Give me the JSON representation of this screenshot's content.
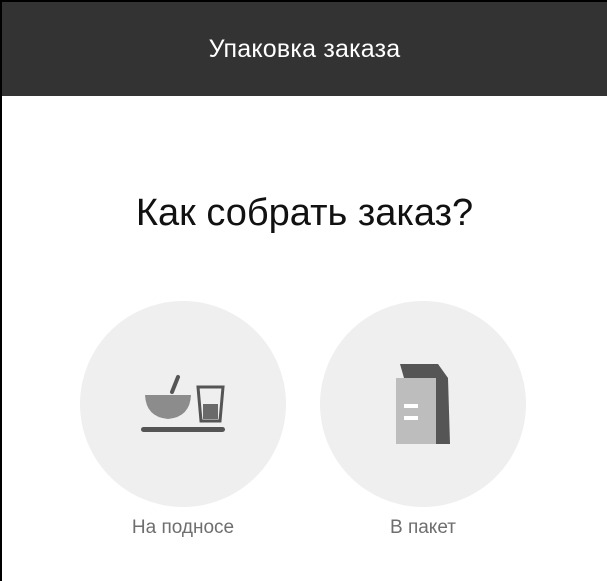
{
  "header": {
    "title": "Упаковка заказа"
  },
  "main": {
    "question": "Как собрать заказ?",
    "options": [
      {
        "label": "На подносе",
        "icon": "tray-icon"
      },
      {
        "label": "В пакет",
        "icon": "bag-icon"
      }
    ]
  },
  "colors": {
    "header_bg": "#333333",
    "circle_bg": "#efefef",
    "icon_dark": "#555555",
    "icon_mid": "#8c8c8c",
    "icon_light": "#bdbdbd"
  }
}
